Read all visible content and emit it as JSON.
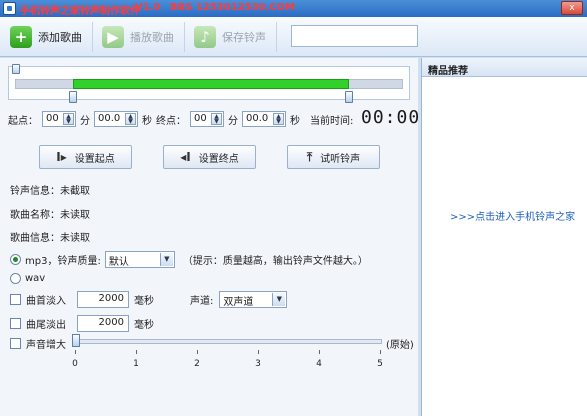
{
  "window": {
    "title": "手机铃声之家铃声制作软件",
    "version": "V1.0",
    "bbs": "BBS 1253012530.COM",
    "close_label": "x"
  },
  "toolbar": {
    "add_label": "添加歌曲",
    "play_label": "播放歌曲",
    "save_label": "保存铃声",
    "search_value": ""
  },
  "time": {
    "start_label": "起点：",
    "start_min": "00",
    "min_unit": "分",
    "start_sec": "00.0",
    "sec_unit": "秒",
    "end_label": "终点：",
    "end_min": "00",
    "end_sec": "00.0",
    "current_label": "当前时间:",
    "current_value": "00:00"
  },
  "buttons": {
    "set_start": "设置起点",
    "set_end": "设置终点",
    "preview": "试听铃声"
  },
  "info": {
    "ring_info": "铃声信息：未截取",
    "song_name": "歌曲名称：未读取",
    "song_info": "歌曲信息：未读取"
  },
  "format": {
    "mp3_label": "mp3，铃声质量:",
    "quality_value": "默认",
    "hint": "（提示：质量越高，输出铃声文件越大。）",
    "wav_label": "wav"
  },
  "effects": {
    "fade_in_label": "曲首淡入",
    "fade_in_value": "2000",
    "fade_out_label": "曲尾淡出",
    "fade_out_value": "2000",
    "ms_unit": "毫秒",
    "channel_label": "声道:",
    "channel_value": "双声道",
    "volume_label": "声音增大",
    "volume_right": "(原始)",
    "volume_level": 0,
    "scale": [
      "0",
      "1",
      "2",
      "3",
      "4",
      "5"
    ]
  },
  "selection": {
    "start_fraction": 0.15,
    "end_fraction": 0.86
  },
  "right_panel": {
    "header": "精品推荐",
    "link": ">>>点击进入手机铃声之家"
  }
}
